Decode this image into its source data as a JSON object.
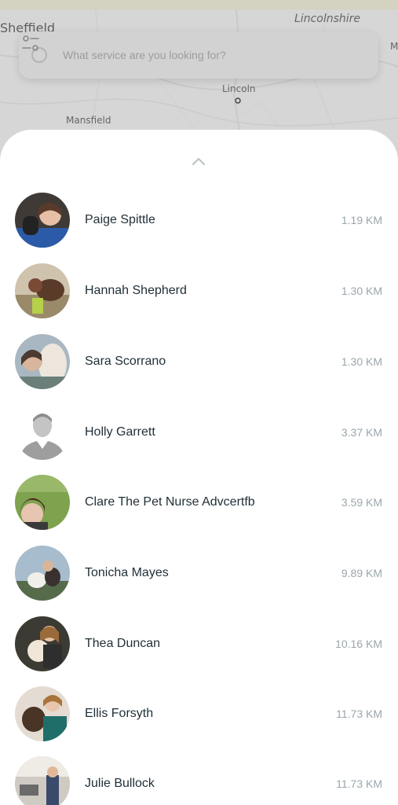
{
  "map": {
    "labels": {
      "sheffield": "Sheffield",
      "lincolnshire": "Lincolnshire",
      "lincoln": "Lincoln",
      "mansfield": "Mansfield",
      "edge": "M"
    }
  },
  "search": {
    "placeholder": "What service are you looking for?"
  },
  "providers": [
    {
      "name": "Paige Spittle",
      "distance": "1.19 KM"
    },
    {
      "name": "Hannah Shepherd",
      "distance": "1.30 KM"
    },
    {
      "name": "Sara Scorrano",
      "distance": "1.30 KM"
    },
    {
      "name": "Holly Garrett",
      "distance": "3.37 KM"
    },
    {
      "name": "Clare The Pet Nurse Advcertfb",
      "distance": "3.59 KM"
    },
    {
      "name": "Tonicha Mayes",
      "distance": "9.89 KM"
    },
    {
      "name": "Thea Duncan",
      "distance": "10.16 KM"
    },
    {
      "name": "Ellis Forsyth",
      "distance": "11.73 KM"
    },
    {
      "name": "Julie Bullock",
      "distance": "11.73 KM"
    }
  ],
  "colors": {
    "name_text": "#1f2e36",
    "distance_text": "#9aa6ac",
    "sheet_bg": "#ffffff",
    "map_bg": "#d6d6d6"
  }
}
